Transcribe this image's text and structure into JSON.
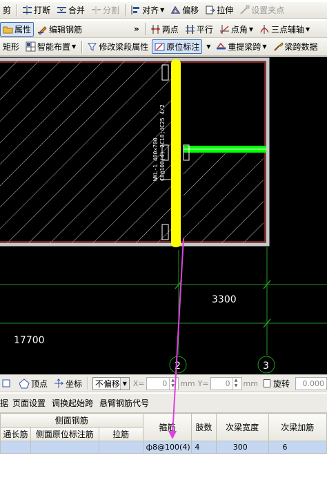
{
  "toolbar_row1": {
    "cut": "剪",
    "break": "打断",
    "merge": "合并",
    "split": "分割",
    "align": "对齐",
    "offset": "偏移",
    "stretch": "拉伸",
    "set_grip": "设置夹点"
  },
  "toolbar_row2": {
    "properties": "属性",
    "edit_rebar": "编辑钢筋",
    "more": "»",
    "two_points": "两点",
    "parallel": "平行",
    "point_angle": "点角",
    "three_point_aux": "三点辅轴"
  },
  "toolbar_row3": {
    "rectangle": "矩形",
    "smart_layout": "智能布置",
    "modify_span_props": "修改梁段属性",
    "in_place_annotation": "原位标注",
    "re_extract_span": "重提梁跨",
    "span_data": "梁跨数据"
  },
  "canvas": {
    "beam_label": "WKL-1 400×700",
    "beam_rebar_line": "C8@100(4) 2C18;4C25 4/2",
    "dim_3300": "3300",
    "dim_17700": "17700",
    "axis_2": "2",
    "axis_3": "3",
    "colors": {
      "background": "#000000",
      "hatch": "#ffffff",
      "wall_outline": "#c8c8c8",
      "wall_red": "#ff4040",
      "highlight_beam": "#ffff00",
      "green_beam": "#00ff00",
      "axis_green": "#1f9a1f",
      "callout": "#e040e0"
    }
  },
  "snapbar": {
    "vertex": "顶点",
    "coordinate": "坐标",
    "no_offset": "不偏移",
    "x_label": "X=",
    "x_value": "0",
    "y_label": "Y=",
    "y_value": "0",
    "mm": "mm",
    "rotate": "旋转",
    "rotate_value": "0.000"
  },
  "tabbar": {
    "tab_cut": "据",
    "page_setup": "页面设置",
    "adjust_start_span": "调换起始跨",
    "cantilever_code": "悬臂钢筋代号"
  },
  "table": {
    "group_side_rebar": "侧面钢筋",
    "col_through_length": "通长筋",
    "col_side_in_place": "侧面原位标注筋",
    "col_tie": "拉筋",
    "col_stirrup": "箍筋",
    "col_legs": "肢数",
    "col_sub_beam_width": "次梁宽度",
    "col_sub_beam_add": "次梁加筋",
    "row": {
      "through_length": "",
      "side_in_place": "",
      "tie": "",
      "stirrup": "ф8@100(4)",
      "legs": "4",
      "sub_beam_width": "300",
      "sub_beam_add": "6"
    }
  }
}
